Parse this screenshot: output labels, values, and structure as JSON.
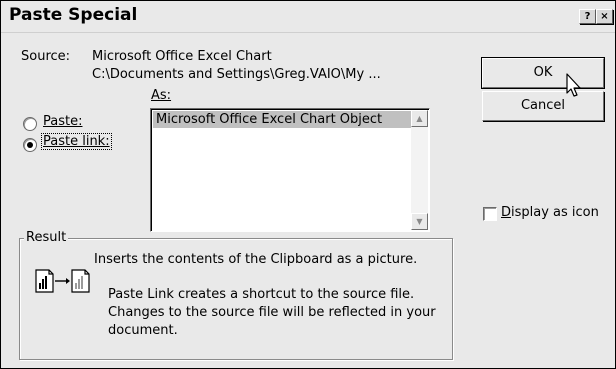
{
  "dialog": {
    "title": "Paste Special",
    "help_button": "?",
    "close_button": "×"
  },
  "source": {
    "label": "Source:",
    "line1": "Microsoft Office Excel Chart",
    "line2": "C:\\Documents and Settings\\Greg.VAIO\\My ..."
  },
  "as_label": "As:",
  "options": {
    "paste_label": "Paste:",
    "paste_link_label": "Paste link:",
    "selected": "paste_link"
  },
  "list": {
    "items": [
      "Microsoft Office Excel Chart Object"
    ],
    "selected_index": 0
  },
  "buttons": {
    "ok": "OK",
    "cancel": "Cancel"
  },
  "display_as_icon": {
    "label": "Display as icon",
    "checked": false
  },
  "result": {
    "title": "Result",
    "text1": "Inserts the contents of the Clipboard as a picture.",
    "text2_line1": "Paste Link creates a shortcut to the source file.",
    "text2_line2": "Changes to the source file will be reflected in your",
    "text2_line3": "document."
  },
  "icons": {
    "help": "question-mark-icon",
    "close": "close-icon",
    "result": "paste-link-chart-icon",
    "cursor": "mouse-pointer-icon"
  },
  "colors": {
    "dialog_bg": "#e9e9e9",
    "selection_bg": "#c0c0c0"
  }
}
